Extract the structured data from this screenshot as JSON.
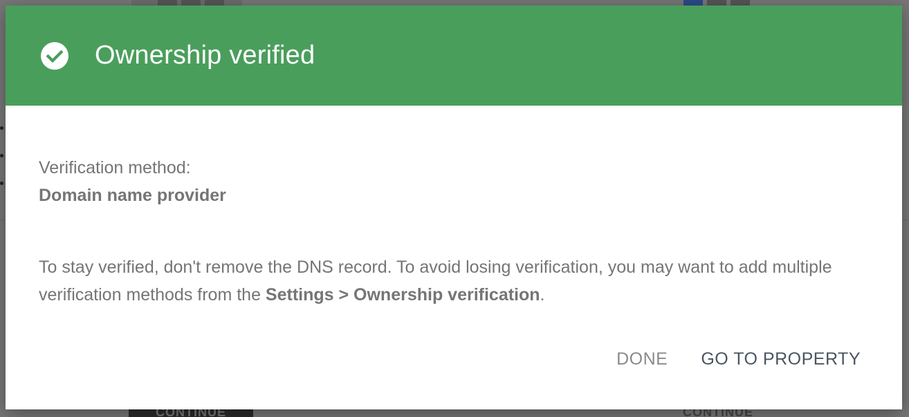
{
  "background": {
    "left_button_label": "CONTINUE",
    "right_button_label": "CONTINUE"
  },
  "dialog": {
    "header_color": "#4a9e5c",
    "icon": "check-circle-icon",
    "title": "Ownership verified",
    "method_label": "Verification method:",
    "method_value": "Domain name provider",
    "notice_text": "To stay verified, don't remove the DNS record. To avoid losing verification, you may want to add multiple verification methods from the ",
    "notice_link": "Settings > Ownership verification",
    "notice_end": ".",
    "actions": {
      "done_label": "DONE",
      "go_label": "GO TO PROPERTY"
    }
  }
}
